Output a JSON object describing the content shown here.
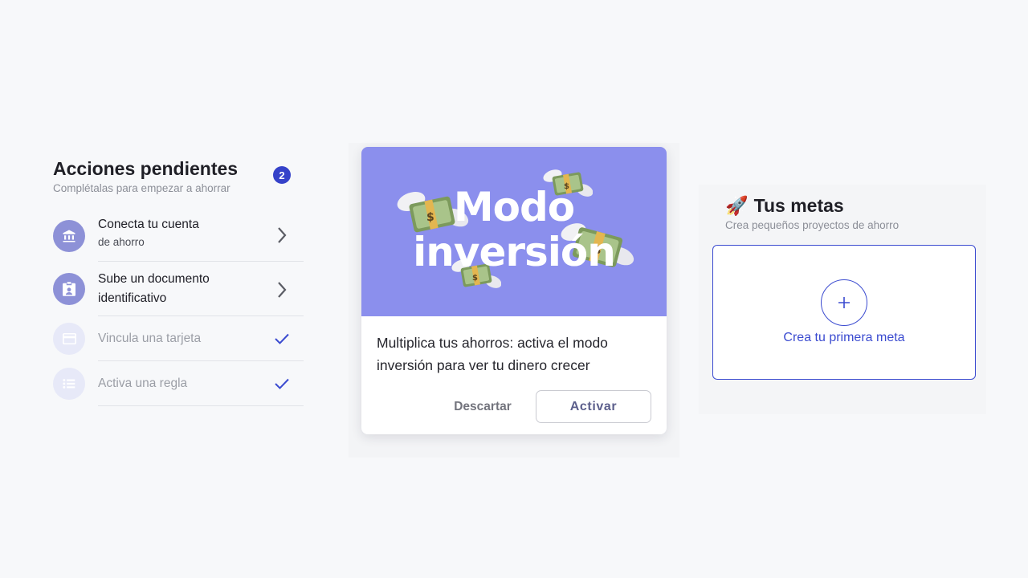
{
  "pending": {
    "title": "Acciones pendientes",
    "subtitle": "Complétalas para empezar a ahorrar",
    "badge_count": "2",
    "items": [
      {
        "line1": "Conecta tu cuenta",
        "line2": "de ahorro",
        "icon": "bank-icon",
        "status": "pending"
      },
      {
        "line1": "Sube un documento",
        "line2": "identificativo",
        "icon": "id-badge-icon",
        "status": "pending"
      },
      {
        "line1": "Vincula una tarjeta",
        "line2": "",
        "icon": "credit-card-icon",
        "status": "done"
      },
      {
        "line1": "Activa una regla",
        "line2": "",
        "icon": "list-icon",
        "status": "done"
      }
    ]
  },
  "promo": {
    "banner_line1": "Modo",
    "banner_line2": "inversión",
    "text": "Multiplica tus ahorros: activa el modo inversión para ver tu dinero crecer",
    "dismiss_label": "Descartar",
    "activate_label": "Activar",
    "banner_color": "#8b8fed",
    "banner_decoration": "money-with-wings-emoji"
  },
  "goals": {
    "emoji": "🚀",
    "title": "Tus metas",
    "subtitle": "Crea pequeños proyectos de ahorro",
    "create_label": "Crea tu primera meta"
  },
  "colors": {
    "accent": "#3b4bd0",
    "badge": "#3542c9",
    "active_icon_bg": "#8d91d7",
    "done_icon_bg": "#e7e9f8",
    "check": "#3b4bd0"
  }
}
